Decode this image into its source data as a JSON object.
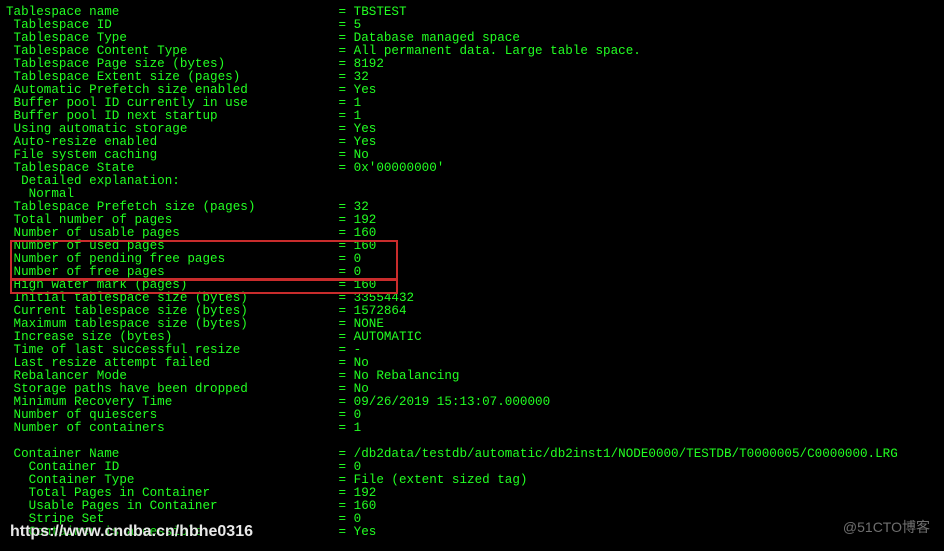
{
  "kv": [
    [
      "Tablespace name",
      "TBSTEST",
      0
    ],
    [
      "Tablespace ID",
      "5",
      1
    ],
    [
      "Tablespace Type",
      "Database managed space",
      1
    ],
    [
      "Tablespace Content Type",
      "All permanent data. Large table space.",
      1
    ],
    [
      "Tablespace Page size (bytes)",
      "8192",
      1
    ],
    [
      "Tablespace Extent size (pages)",
      "32",
      1
    ],
    [
      "Automatic Prefetch size enabled",
      "Yes",
      1
    ],
    [
      "Buffer pool ID currently in use",
      "1",
      1
    ],
    [
      "Buffer pool ID next startup",
      "1",
      1
    ],
    [
      "Using automatic storage",
      "Yes",
      1
    ],
    [
      "Auto-resize enabled",
      "Yes",
      1
    ],
    [
      "File system caching",
      "No",
      1
    ],
    [
      "Tablespace State",
      "0x'00000000'",
      1
    ],
    [
      "Detailed explanation:",
      null,
      2
    ],
    [
      "Normal",
      null,
      3
    ],
    [
      "Tablespace Prefetch size (pages)",
      "32",
      1
    ],
    [
      "Total number of pages",
      "192",
      1
    ],
    [
      "Number of usable pages",
      "160",
      1
    ],
    [
      "Number of used pages",
      "160",
      1
    ],
    [
      "Number of pending free pages",
      "0",
      1
    ],
    [
      "Number of free pages",
      "0",
      1
    ],
    [
      "High water mark (pages)",
      "160",
      1
    ],
    [
      "Initial tablespace size (bytes)",
      "33554432",
      1
    ],
    [
      "Current tablespace size (bytes)",
      "1572864",
      1
    ],
    [
      "Maximum tablespace size (bytes)",
      "NONE",
      1
    ],
    [
      "Increase size (bytes)",
      "AUTOMATIC",
      1
    ],
    [
      "Time of last successful resize",
      "-",
      1
    ],
    [
      "Last resize attempt failed",
      "No",
      1
    ],
    [
      "Rebalancer Mode",
      "No Rebalancing",
      1
    ],
    [
      "Storage paths have been dropped",
      "No",
      1
    ],
    [
      "Minimum Recovery Time",
      "09/26/2019 15:13:07.000000",
      1
    ],
    [
      "Number of quiescers",
      "0",
      1
    ],
    [
      "Number of containers",
      "1",
      1
    ],
    [
      "",
      null,
      0
    ],
    [
      "Container Name",
      "/db2data/testdb/automatic/db2inst1/NODE0000/TESTDB/T0000005/C0000000.LRG",
      1
    ],
    [
      "Container ID",
      "0",
      3
    ],
    [
      "Container Type",
      "File (extent sized tag)",
      3
    ],
    [
      "Total Pages in Container",
      "192",
      3
    ],
    [
      "Usable Pages in Container",
      "160",
      3
    ],
    [
      "Stripe Set",
      "0",
      3
    ],
    [
      "Container is accessible",
      "Yes",
      3
    ]
  ],
  "layout": {
    "label_col": 44,
    "indent_per_level": 1,
    "indent_char": " "
  },
  "watermarks": {
    "left": "https://www.cndba.cn/hbhe0316",
    "right": "@51CTO博客"
  }
}
